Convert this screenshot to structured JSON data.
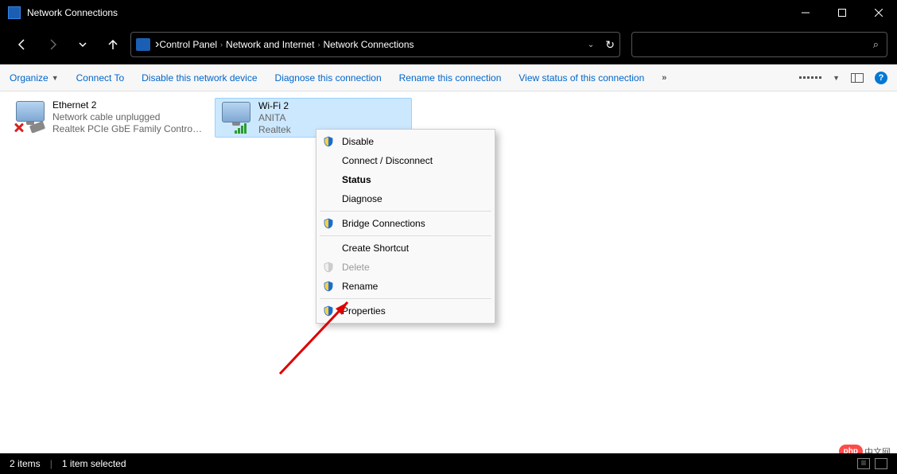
{
  "window": {
    "title": "Network Connections"
  },
  "breadcrumb": {
    "items": [
      "Control Panel",
      "Network and Internet",
      "Network Connections"
    ]
  },
  "toolbar": {
    "organize": "Organize",
    "connect_to": "Connect To",
    "disable": "Disable this network device",
    "diagnose": "Diagnose this connection",
    "rename": "Rename this connection",
    "view_status": "View status of this connection"
  },
  "connections": {
    "ethernet": {
      "name": "Ethernet 2",
      "status": "Network cable unplugged",
      "device": "Realtek PCIe GbE Family Controller"
    },
    "wifi": {
      "name": "Wi-Fi 2",
      "status": "ANITA",
      "device": "Realtek "
    }
  },
  "context_menu": {
    "disable": "Disable",
    "connect_disconnect": "Connect / Disconnect",
    "status": "Status",
    "diagnose": "Diagnose",
    "bridge": "Bridge Connections",
    "create_shortcut": "Create Shortcut",
    "delete": "Delete",
    "rename": "Rename",
    "properties": "Properties"
  },
  "statusbar": {
    "count": "2 items",
    "selected": "1 item selected"
  },
  "watermark": {
    "logo": "php",
    "text": "中文网"
  }
}
